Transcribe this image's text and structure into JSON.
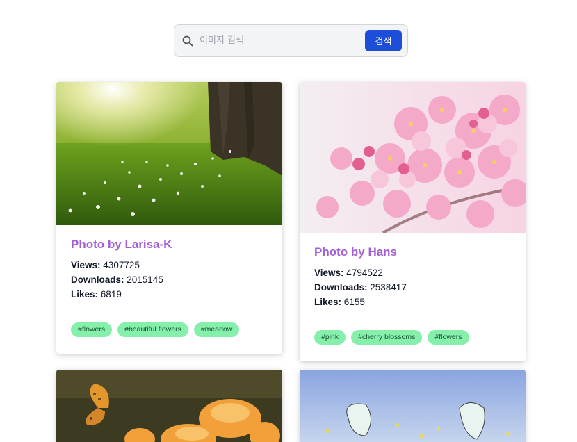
{
  "search": {
    "placeholder": "이미지 검색",
    "button_label": "검색",
    "icon": "search-icon"
  },
  "labels": {
    "views": "Views:",
    "downloads": "Downloads:",
    "likes": "Likes:"
  },
  "colors": {
    "title": "#a35fd6",
    "tag_bg": "#86efac",
    "button_bg": "#1d4ed8"
  },
  "cards": [
    {
      "title": "Photo by Larisa-K",
      "views": "4307725",
      "downloads": "2015145",
      "likes": "6819",
      "tags": [
        "#flowers",
        "#beautiful flowers",
        "#meadow"
      ]
    },
    {
      "title": "Photo by Hans",
      "views": "4794522",
      "downloads": "2538417",
      "likes": "6155",
      "tags": [
        "#pink",
        "#cherry blossoms",
        "#flowers"
      ]
    },
    {
      "title": "",
      "views": "",
      "downloads": "",
      "likes": "",
      "tags": []
    },
    {
      "title": "",
      "views": "",
      "downloads": "",
      "likes": "",
      "tags": []
    }
  ]
}
